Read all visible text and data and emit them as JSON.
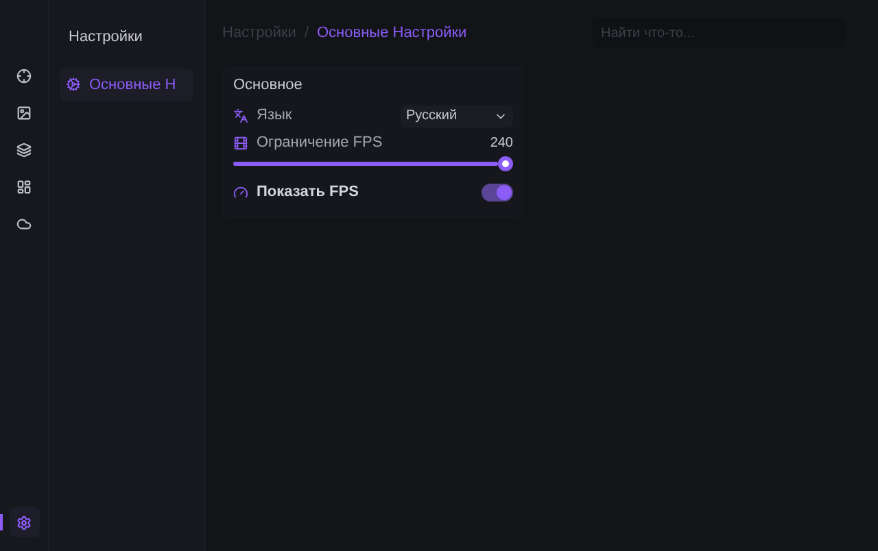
{
  "rail": [
    {
      "kind": "crosshair",
      "selected": false
    },
    {
      "kind": "image",
      "selected": false
    },
    {
      "kind": "layers",
      "selected": false
    },
    {
      "kind": "dashboard",
      "selected": false
    },
    {
      "kind": "cloud",
      "selected": false
    }
  ],
  "rail_bottom": {
    "kind": "settings",
    "selected": true
  },
  "sidebar": {
    "title": "Настройки",
    "items": [
      {
        "label": "Основные Н",
        "selected": true
      }
    ]
  },
  "breadcrumb": [
    "Настройки",
    "Основные Настройки"
  ],
  "breadcrumb_separator": "/",
  "search": {
    "placeholder": "Найти что-то..."
  },
  "section": {
    "title": "Основное",
    "rows": [
      {
        "kind": "select",
        "label": "Язык",
        "value": "Русский"
      },
      {
        "kind": "slider",
        "label": "Ограничение FPS",
        "reading": "240",
        "level": 1
      },
      {
        "kind": "toggle",
        "label": "Показать FPS",
        "on": true
      }
    ]
  }
}
